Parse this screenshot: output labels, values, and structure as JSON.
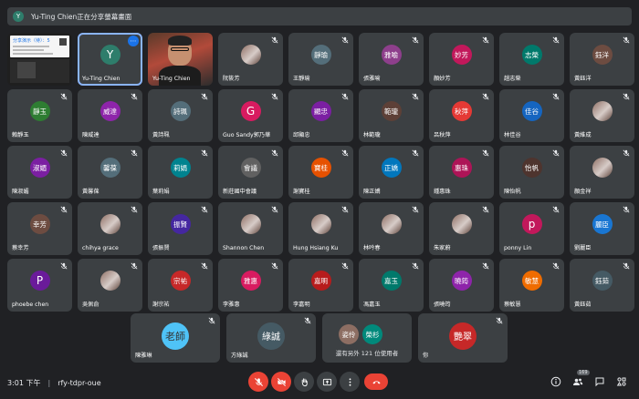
{
  "banner": {
    "avatar_letter": "Y",
    "text": "Yu-Ting Chien正在分享螢幕畫面"
  },
  "tiles": [
    {
      "kind": "screen",
      "name": "",
      "slide_title": "分享演示（待）：5"
    },
    {
      "kind": "letter",
      "name": "Yu-Ting Chien",
      "avatar": "Y",
      "color": "#2e7d6b",
      "highlight": true
    },
    {
      "kind": "video",
      "name": "Yu-Ting Chien"
    },
    {
      "kind": "photo",
      "name": "阮筱芳",
      "avatar": ""
    },
    {
      "kind": "text",
      "name": "王靜瑜",
      "avatar": "靜瑜",
      "color": "#546e7a"
    },
    {
      "kind": "text",
      "name": "張雅喻",
      "avatar": "雅喻",
      "color": "#8e3f8c"
    },
    {
      "kind": "text",
      "name": "顏妙芳",
      "avatar": "妙芳",
      "color": "#c2185b"
    },
    {
      "kind": "text",
      "name": "趙志榮",
      "avatar": "志榮",
      "color": "#00796b"
    },
    {
      "kind": "text",
      "name": "黃鈺洋",
      "avatar": "鈺洋",
      "color": "#6d4c41"
    },
    {
      "kind": "text",
      "name": "賴靜玉",
      "avatar": "靜玉",
      "color": "#2e7d32"
    },
    {
      "kind": "text",
      "name": "陳威達",
      "avatar": "威達",
      "color": "#8e24aa"
    },
    {
      "kind": "text",
      "name": "黃詩珮",
      "avatar": "詩珮",
      "color": "#546e7a"
    },
    {
      "kind": "letter",
      "name": "Guo Sandy郭乃華",
      "avatar": "G",
      "color": "#d81b60"
    },
    {
      "kind": "text",
      "name": "邱顯忠",
      "avatar": "顯忠",
      "color": "#7b1fa2"
    },
    {
      "kind": "text",
      "name": "林範瓏",
      "avatar": "範瓏",
      "color": "#5d4037"
    },
    {
      "kind": "text",
      "name": "呂秋萍",
      "avatar": "秋萍",
      "color": "#e53935"
    },
    {
      "kind": "text",
      "name": "林佳谷",
      "avatar": "佳谷",
      "color": "#1565c0"
    },
    {
      "kind": "photo",
      "name": "黃維成",
      "avatar": ""
    },
    {
      "kind": "text",
      "name": "陳淑媚",
      "avatar": "淑媚",
      "color": "#7b1fa2"
    },
    {
      "kind": "text",
      "name": "黃馨葆",
      "avatar": "馨葆",
      "color": "#546e7a"
    },
    {
      "kind": "text",
      "name": "葉莉娟",
      "avatar": "莉娟",
      "color": "#00838f"
    },
    {
      "kind": "text",
      "name": "新莊國中會議",
      "avatar": "會議",
      "color": "#616161"
    },
    {
      "kind": "text",
      "name": "謝寶桂",
      "avatar": "寶桂",
      "color": "#e65100"
    },
    {
      "kind": "text",
      "name": "陳正嬌",
      "avatar": "正嬌",
      "color": "#0277bd"
    },
    {
      "kind": "text",
      "name": "鍾惠珠",
      "avatar": "惠珠",
      "color": "#ad1457"
    },
    {
      "kind": "text",
      "name": "陳怡帆",
      "avatar": "怡帆",
      "color": "#4e342e"
    },
    {
      "kind": "photo",
      "name": "顏金祥",
      "avatar": ""
    },
    {
      "kind": "text",
      "name": "蔡幸芳",
      "avatar": "幸芳",
      "color": "#6d4c41"
    },
    {
      "kind": "photo",
      "name": "chihya grace",
      "avatar": ""
    },
    {
      "kind": "text",
      "name": "張振賢",
      "avatar": "振賢",
      "color": "#4527a0"
    },
    {
      "kind": "photo",
      "name": "Shannon Chen",
      "avatar": ""
    },
    {
      "kind": "photo",
      "name": "Hung Hsiang Ku",
      "avatar": ""
    },
    {
      "kind": "photo",
      "name": "林吟春",
      "avatar": ""
    },
    {
      "kind": "photo",
      "name": "朱家蔚",
      "avatar": ""
    },
    {
      "kind": "letter",
      "name": "ponny Lin",
      "avatar": "p",
      "color": "#c2185b"
    },
    {
      "kind": "text",
      "name": "劉麗臣",
      "avatar": "麗臣",
      "color": "#1976d2"
    },
    {
      "kind": "letter",
      "name": "phoebe chen",
      "avatar": "P",
      "color": "#6a1b9a"
    },
    {
      "kind": "photo",
      "name": "吳佩俞",
      "avatar": ""
    },
    {
      "kind": "text",
      "name": "謝宗祐",
      "avatar": "宗祐",
      "color": "#c62828"
    },
    {
      "kind": "text",
      "name": "李雅惠",
      "avatar": "雅惠",
      "color": "#d81b60"
    },
    {
      "kind": "text",
      "name": "李嘉明",
      "avatar": "嘉明",
      "color": "#b71c1c"
    },
    {
      "kind": "text",
      "name": "馮嘉玉",
      "avatar": "嘉玉",
      "color": "#00796b"
    },
    {
      "kind": "text",
      "name": "張曉筠",
      "avatar": "曉筠",
      "color": "#8e24aa"
    },
    {
      "kind": "text",
      "name": "蔡敏慧",
      "avatar": "敏慧",
      "color": "#ef6c00"
    },
    {
      "kind": "text",
      "name": "黃鈺茹",
      "avatar": "鈺茹",
      "color": "#455a64"
    }
  ],
  "bottom_tiles": [
    {
      "name": "陳雅琳",
      "avatar": "老師",
      "color": "#4fc3f7"
    },
    {
      "name": "方綠誠",
      "avatar": "綠誠",
      "color": "#455a64"
    },
    {
      "name": "還有另外 121 位使用者",
      "avatar1": "姿伶",
      "avatar2": "榮杉",
      "color1": "#8d6e63",
      "color2": "#00897b"
    },
    {
      "name": "你",
      "avatar": "艷翠",
      "color": "#c62828"
    }
  ],
  "bottombar": {
    "time": "3:01 下午",
    "meeting_code": "rfy-tdpr-oue",
    "participant_count": "169"
  },
  "colors": {
    "bg": "#202124",
    "tile": "#3c4043",
    "red": "#ea4335",
    "accent": "#8ab4f8"
  }
}
